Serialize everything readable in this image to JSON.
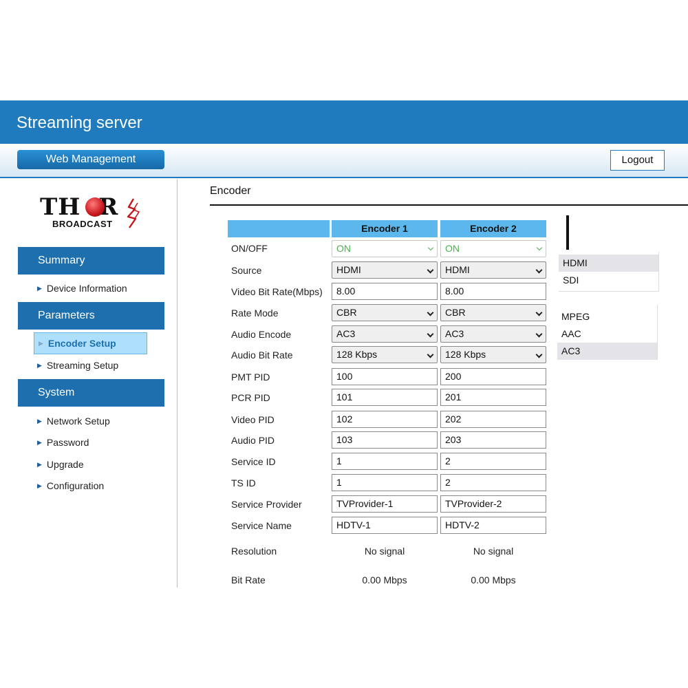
{
  "header": {
    "app_title": "Streaming server",
    "web_management_label": "Web Management",
    "logout_label": "Logout"
  },
  "logo": {
    "brand_main": "THOR",
    "brand_sub": "BROADCAST"
  },
  "sidebar": {
    "summary": {
      "label": "Summary",
      "items": [
        "Device Information"
      ]
    },
    "parameters": {
      "label": "Parameters",
      "items": [
        "Encoder Setup",
        "Streaming Setup"
      ],
      "active": "Encoder Setup"
    },
    "system": {
      "label": "System",
      "items": [
        "Network Setup",
        "Password",
        "Upgrade",
        "Configuration"
      ]
    }
  },
  "main": {
    "title": "Encoder",
    "columns": [
      "",
      "Encoder 1",
      "Encoder 2"
    ],
    "labels": {
      "onoff": "ON/OFF",
      "source": "Source",
      "video_bitrate": "Video Bit Rate(Mbps)",
      "rate_mode": "Rate Mode",
      "audio_encode": "Audio Encode",
      "audio_bitrate": "Audio Bit Rate",
      "pmt_pid": "PMT PID",
      "pcr_pid": "PCR PID",
      "video_pid": "Video PID",
      "audio_pid": "Audio PID",
      "service_id": "Service ID",
      "ts_id": "TS ID",
      "service_provider": "Service Provider",
      "service_name": "Service Name",
      "resolution": "Resolution",
      "bit_rate": "Bit Rate"
    },
    "encoder1": {
      "onoff": "ON",
      "source": "HDMI",
      "video_bitrate": "8.00",
      "rate_mode": "CBR",
      "audio_encode": "AC3",
      "audio_bitrate": "128 Kbps",
      "pmt_pid": "100",
      "pcr_pid": "101",
      "video_pid": "102",
      "audio_pid": "103",
      "service_id": "1",
      "ts_id": "1",
      "service_provider": "TVProvider-1",
      "service_name": "HDTV-1",
      "resolution": "No signal",
      "bit_rate": "0.00 Mbps"
    },
    "encoder2": {
      "onoff": "ON",
      "source": "HDMI",
      "video_bitrate": "8.00",
      "rate_mode": "CBR",
      "audio_encode": "AC3",
      "audio_bitrate": "128 Kbps",
      "pmt_pid": "200",
      "pcr_pid": "201",
      "video_pid": "202",
      "audio_pid": "203",
      "service_id": "2",
      "ts_id": "2",
      "service_provider": "TVProvider-2",
      "service_name": "HDTV-2",
      "resolution": "No signal",
      "bit_rate": "0.00 Mbps"
    }
  },
  "dropdowns": {
    "source_options": [
      "HDMI",
      "SDI"
    ],
    "source_highlight": "HDMI",
    "audio_options": [
      "MPEG",
      "AAC",
      "AC3"
    ],
    "audio_highlight": "AC3"
  },
  "colors": {
    "primary": "#1f7bbd",
    "nav": "#1d6fae",
    "table_head": "#5cb8ec",
    "on_green": "#4caf50"
  }
}
